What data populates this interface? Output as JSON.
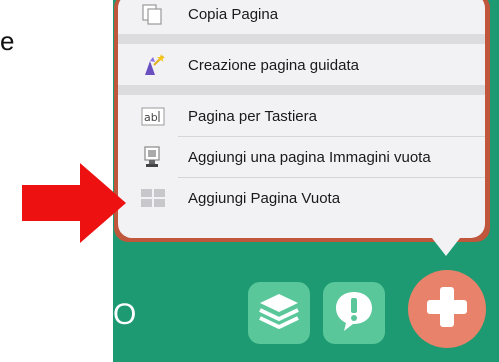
{
  "left_caption": "e",
  "menu": {
    "items": [
      {
        "label": "Copia Pagina",
        "icon": "copy-page-icon"
      },
      {
        "label": "Creazione pagina guidata",
        "icon": "wizard-icon"
      },
      {
        "label": "Pagina per Tastiera",
        "icon": "keyboard-page-icon"
      },
      {
        "label": "Aggiungi una pagina Immagini vuota",
        "icon": "image-page-icon"
      },
      {
        "label": "Aggiungi Pagina Vuota",
        "icon": "blank-page-icon"
      }
    ]
  },
  "bottom_bar": {
    "partial_label": "O",
    "buttons": [
      {
        "name": "layers-icon"
      },
      {
        "name": "alert-icon"
      },
      {
        "name": "add-icon"
      }
    ]
  },
  "colors": {
    "app_green": "#1d9a72",
    "button_green": "#59c79a",
    "add_orange": "#e9826a",
    "arrow_red": "#ee1111"
  }
}
